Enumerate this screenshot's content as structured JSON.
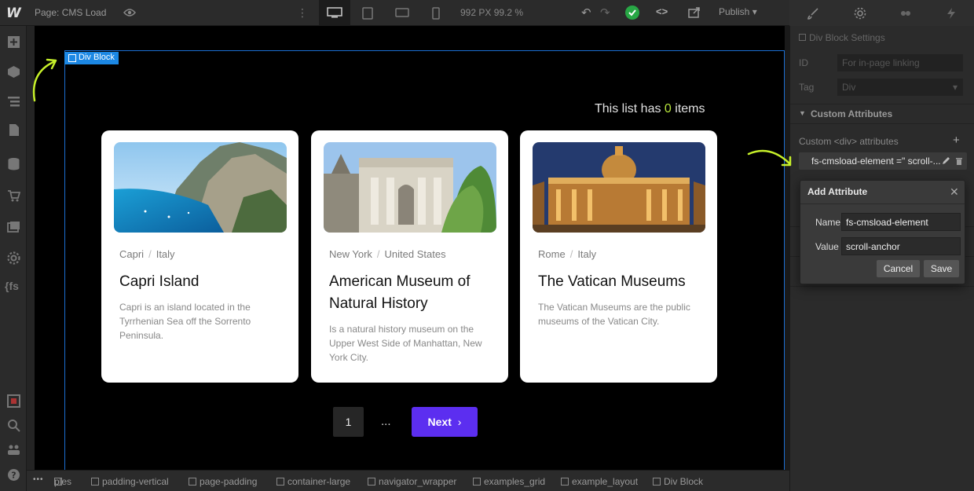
{
  "topbar": {
    "logo": "W",
    "page_label": "Page: CMS Load",
    "kebab": "⋮",
    "size_readout": "992 PX  99.2 %",
    "undo": "↶",
    "redo": "↷",
    "code_label": "<>",
    "publish_label": "Publish ▾"
  },
  "canvas": {
    "selected_tag": "Div Block",
    "count_prefix": "This list has ",
    "count_value": "0",
    "count_suffix": " items",
    "cards": [
      {
        "city": "Capri",
        "country": "Italy",
        "title": "Capri Island",
        "description": "Capri is an island located in the Tyrrhenian Sea off the Sorrento Peninsula.",
        "image": "coastal-cliffs-photo"
      },
      {
        "city": "New York",
        "country": "United States",
        "title": "American Museum of Natural History",
        "description": "Is a natural history museum on the Upper West Side of Manhattan, New York City.",
        "image": "museum-facade-photo"
      },
      {
        "city": "Rome",
        "country": "Italy",
        "title": "The Vatican Museums",
        "description": "The Vatican Museums are the public museums of the Vatican City.",
        "image": "vatican-night-photo"
      }
    ],
    "location_separator": "/",
    "pagination": {
      "page": "1",
      "ellipsis": "...",
      "next_label": "Next"
    }
  },
  "panel": {
    "settings_title": "Div Block Settings",
    "id_label": "ID",
    "id_placeholder": "For in-page linking",
    "tag_label": "Tag",
    "tag_value": "Div",
    "custom_attributes_title": "Custom Attributes",
    "custom_attributes_label": "Custom <div> attributes",
    "add_symbol": "+",
    "attribute_row": "fs-cmsload-element =\" scroll-..."
  },
  "dialog": {
    "title": "Add Attribute",
    "close": "✕",
    "name_label": "Name",
    "name_value": "fs-cmsload-element",
    "value_label": "Value",
    "value_value": "scroll-anchor",
    "cancel_label": "Cancel",
    "save_label": "Save"
  },
  "breadcrumbs": {
    "more": "•••",
    "items": [
      "ples",
      "padding-vertical",
      "page-padding",
      "container-large",
      "navigator_wrapper",
      "examples_grid",
      "example_layout",
      "Div Block"
    ]
  },
  "colors": {
    "accent_purple": "#5c2ef0",
    "count_green": "#b7e53c",
    "selection_blue": "#1c88e4",
    "arrow_green": "#c6f02a"
  }
}
